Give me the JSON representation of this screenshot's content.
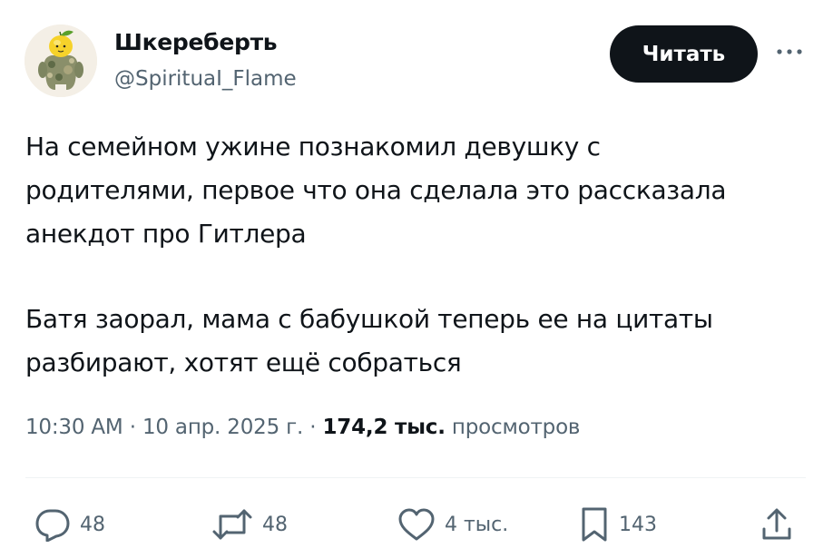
{
  "author": {
    "display_name": "Шкереберть",
    "handle": "@SpirituaI_Flame"
  },
  "follow_button_label": "Читать",
  "tweet": {
    "paragraph1": [
      "На семейном ужине познакомил девушку с",
      "родителями, первое что она сделала это рассказала",
      "анекдот про Гитлера"
    ],
    "paragraph2": [
      "Батя заорал, мама с бабушкой теперь ее на цитаты",
      "разбирают, хотят ещё собраться"
    ]
  },
  "meta": {
    "time": "10:30 AM",
    "separator": "·",
    "date": "10 апр. 2025 г.",
    "views_count": "174,2 тыс.",
    "views_label": "просмотров"
  },
  "actions": {
    "replies": "48",
    "reposts": "48",
    "likes": "4 тыс.",
    "bookmarks": "143"
  },
  "icons": {
    "reply": "reply-icon",
    "repost": "repost-icon",
    "like": "heart-icon",
    "bookmark": "bookmark-icon",
    "share": "share-icon",
    "more": "more-icon"
  },
  "colors": {
    "text": "#0f1419",
    "secondary": "#536471",
    "button_bg": "#0f1419",
    "divider": "#eff3f4"
  }
}
